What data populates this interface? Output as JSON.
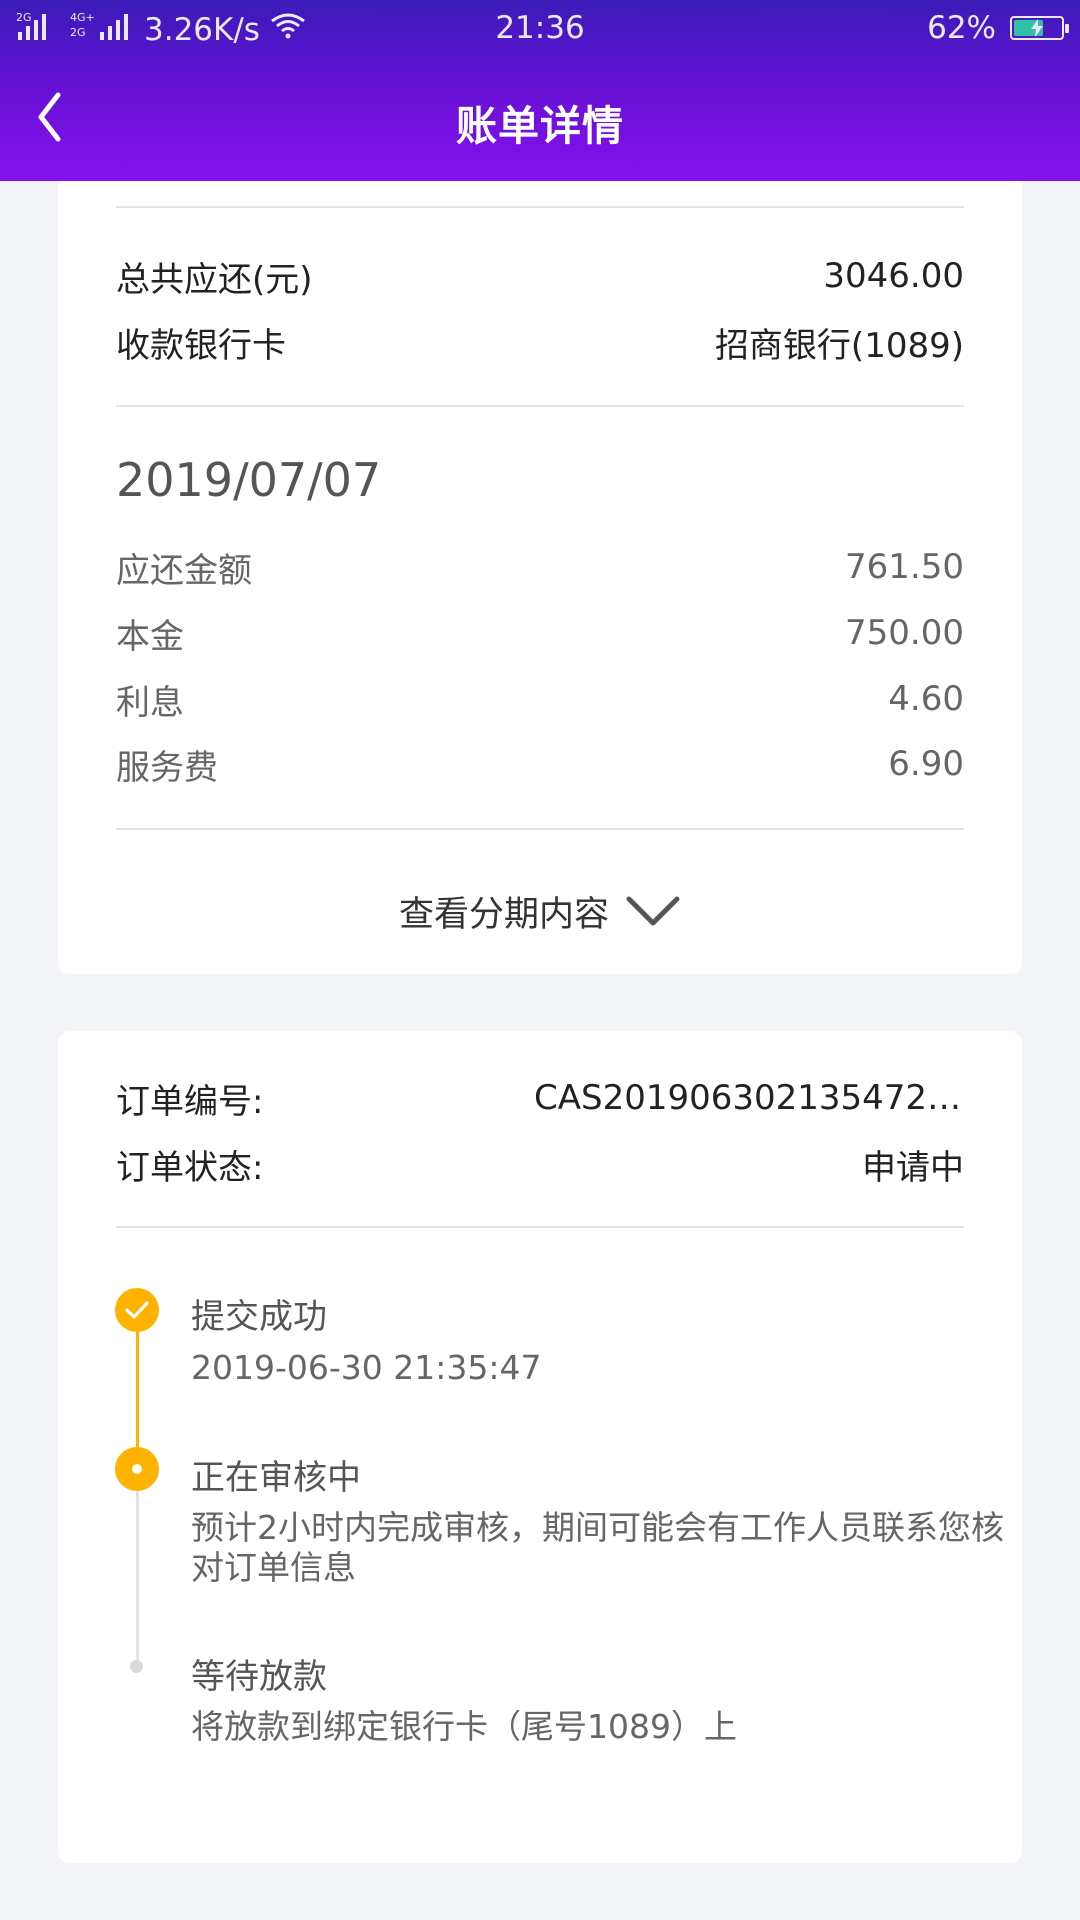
{
  "status_bar": {
    "network_left": "2G",
    "network_right": "4G+ 2G",
    "speed": "3.26K/s",
    "time": "21:36",
    "battery_pct_text": "62%",
    "battery_level": 0.62,
    "battery_color": "#2ed3a3"
  },
  "header": {
    "title": "账单详情",
    "back_icon": "chevron-left-icon"
  },
  "summary": {
    "total_label": "总共应还(元)",
    "total_value": "3046.00",
    "bank_label": "收款银行卡",
    "bank_value": "招商银行(1089)"
  },
  "installment": {
    "date": "2019/07/07",
    "rows": [
      {
        "label": "应还金额",
        "value": "761.50"
      },
      {
        "label": "本金",
        "value": "750.00"
      },
      {
        "label": "利息",
        "value": "4.60"
      },
      {
        "label": "服务费",
        "value": "6.90"
      }
    ],
    "toggle_label": "查看分期内容",
    "toggle_icon": "chevron-down-icon"
  },
  "order": {
    "id_label": "订单编号:",
    "id_value": "CAS2019063021354726...",
    "status_label": "订单状态:",
    "status_value": "申请中"
  },
  "timeline": [
    {
      "title": "提交成功",
      "desc": "2019-06-30 21:35:47",
      "state": "done"
    },
    {
      "title": "正在审核中",
      "desc": "预计2小时内完成审核，期间可能会有工作人员联系您核对订单信息",
      "state": "active"
    },
    {
      "title": "等待放款",
      "desc": "将放款到绑定银行卡（尾号1089）上",
      "state": "pending"
    }
  ],
  "colors": {
    "header_gradient_start": "#3a1bb8",
    "header_gradient_end": "#8411ee",
    "timeline_accent": "#ffb300"
  }
}
